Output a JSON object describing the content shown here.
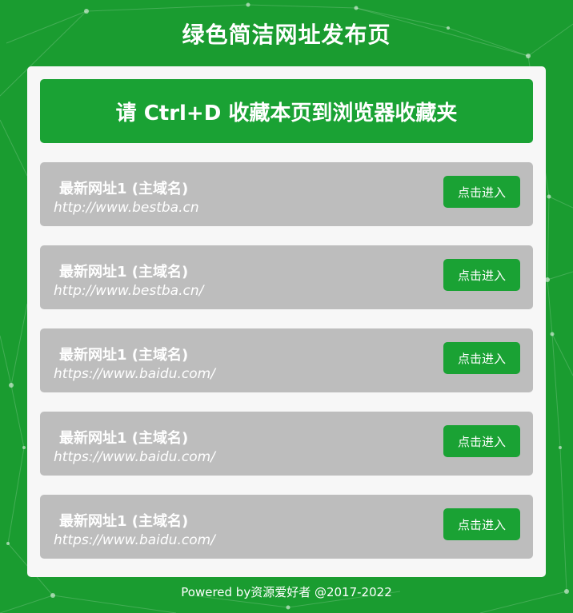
{
  "header": {
    "title": "绿色简洁网址发布页"
  },
  "banner": {
    "text": "请 Ctrl+D 收藏本页到浏览器收藏夹"
  },
  "links": [
    {
      "name": "最新网址1 (主域名)",
      "url": "http://www.bestba.cn",
      "button": "点击进入"
    },
    {
      "name": "最新网址1 (主域名)",
      "url": "http://www.bestba.cn/",
      "button": "点击进入"
    },
    {
      "name": "最新网址1 (主域名)",
      "url": "https://www.baidu.com/",
      "button": "点击进入"
    },
    {
      "name": "最新网址1 (主域名)",
      "url": "https://www.baidu.com/",
      "button": "点击进入"
    },
    {
      "name": "最新网址1 (主域名)",
      "url": "https://www.baidu.com/",
      "button": "点击进入"
    }
  ],
  "footer": {
    "text": "Powered by资源爱好者 @2017-2022"
  },
  "colors": {
    "background": "#1a9c30",
    "accent": "#1aa234",
    "card": "#f7f7f7",
    "row": "#bdbdbd"
  }
}
